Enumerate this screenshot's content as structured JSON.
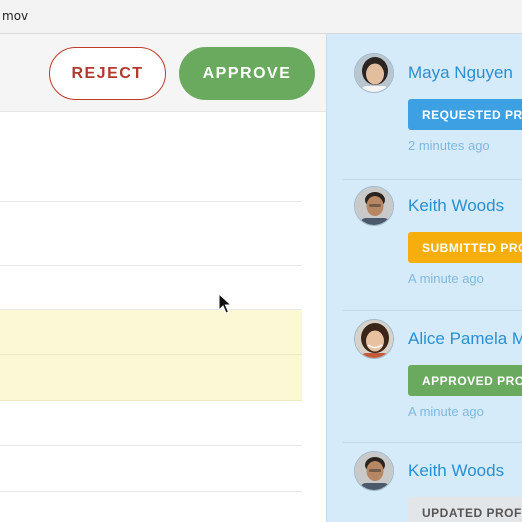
{
  "window": {
    "title": "mov"
  },
  "toolbar": {
    "reject_label": "REJECT",
    "approve_label": "APPROVE"
  },
  "activity": [
    {
      "name": "Maya Nguyen",
      "badge": "REQUESTED PROFILE",
      "badge_color": "#3da0e3",
      "badge_text_color": "#ffffff",
      "time": "2 minutes ago",
      "avatar": "avatar-woman-icon"
    },
    {
      "name": "Keith Woods",
      "badge": "SUBMITTED PROFILE",
      "badge_color": "#f5ae0b",
      "badge_text_color": "#ffffff",
      "time": "A minute ago",
      "avatar": "avatar-man-icon"
    },
    {
      "name": "Alice Pamela Moore",
      "badge": "APPROVED PROFILE",
      "badge_color": "#6aaa5e",
      "badge_text_color": "#ffffff",
      "time": "A minute ago",
      "avatar": "avatar-woman-icon"
    },
    {
      "name": "Keith Woods",
      "badge": "UPDATED PROFILE",
      "badge_color": "#e3e6e9",
      "badge_text_color": "#555555",
      "time": "",
      "avatar": "avatar-man-icon"
    }
  ],
  "colors": {
    "accent_blue": "#2a8fd0",
    "reject": "#b03a2e",
    "approve": "#6aaa5e",
    "highlight_row": "#fcf8d6",
    "panel_bg": "#d6ebfa"
  }
}
